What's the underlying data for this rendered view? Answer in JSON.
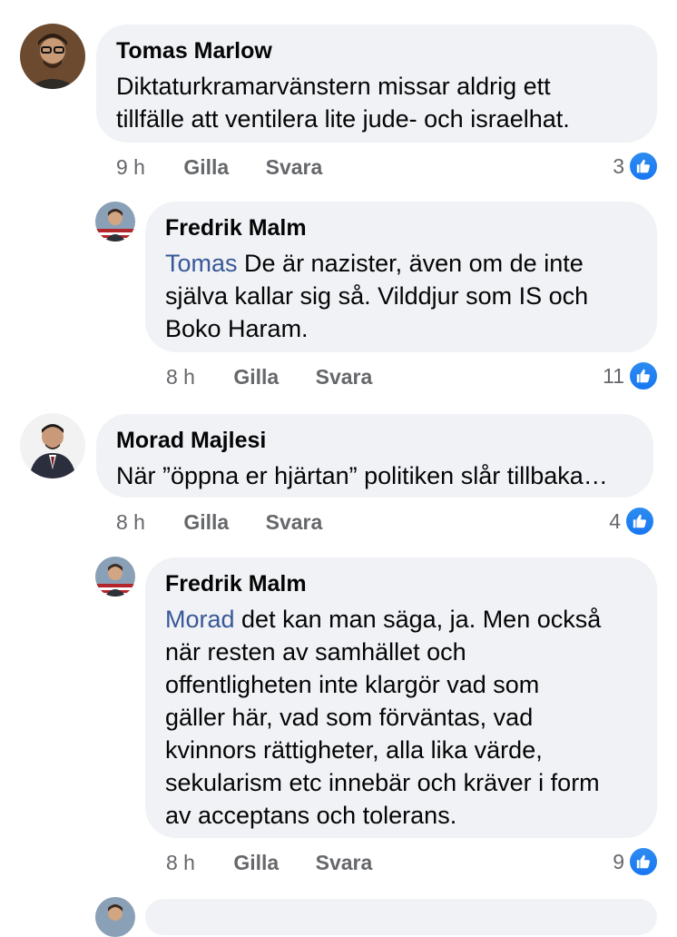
{
  "comments": [
    {
      "author": "Tomas Marlow",
      "text_lines": [
        "Diktaturkramarvänstern missar aldrig ett",
        "tillfälle att ventilera lite jude- och israelhat."
      ],
      "time": "9 h",
      "like_label": "Gilla",
      "reply_label": "Svara",
      "likes": "3"
    },
    {
      "author": "Fredrik Malm",
      "mention": "Tomas",
      "text_first_rest": " De är nazister, även om de inte",
      "text_lines": [
        "själva kallar sig så. Vilddjur som IS och",
        "Boko Haram."
      ],
      "time": "8 h",
      "like_label": "Gilla",
      "reply_label": "Svara",
      "likes": "11"
    },
    {
      "author": "Morad Majlesi",
      "text_lines": [
        "När ”öppna er hjärtan” politiken slår tillbaka…"
      ],
      "time": "8 h",
      "like_label": "Gilla",
      "reply_label": "Svara",
      "likes": "4"
    },
    {
      "author": "Fredrik Malm",
      "mention": "Morad",
      "text_first_rest": " det kan man säga, ja. Men också",
      "text_lines": [
        "när resten av samhället och",
        "offentligheten inte klargör vad som",
        "gäller här, vad som förväntas, vad",
        "kvinnors rättigheter, alla lika värde,",
        "sekularism etc innebär och kräver i form",
        "av acceptans och tolerans."
      ],
      "time": "8 h",
      "like_label": "Gilla",
      "reply_label": "Svara",
      "likes": "9"
    }
  ],
  "icons": {
    "like": "thumbs-up-icon"
  },
  "colors": {
    "bubble": "#f0f2f5",
    "mention": "#385898",
    "like_blue": "#1877f2",
    "meta_gray": "#65676b"
  }
}
